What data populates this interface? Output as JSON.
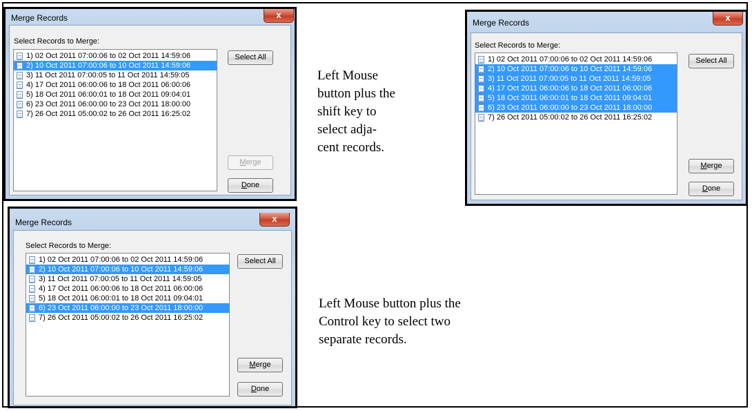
{
  "dialog": {
    "title": "Merge Records",
    "close_glyph": "x",
    "prompt": "Select Records to Merge:",
    "select_all_label": "Select All",
    "merge_label_rest": "erge",
    "merge_label_mnemonic": "M",
    "done_label_rest": "one",
    "done_label_mnemonic": "D"
  },
  "records": [
    "1) 02 Oct 2011 07:00:06 to 02 Oct 2011 14:59:06",
    "2) 10 Oct 2011 07:00:06 to 10 Oct 2011 14:59:06",
    "3) 11 Oct 2011 07:00:05 to 11 Oct 2011 14:59:05",
    "4) 17 Oct 2011 06:00:06 to 18 Oct 2011 06:00:06",
    "5) 18 Oct 2011 06:00:01 to 18 Oct 2011 09:04:01",
    "6) 23 Oct 2011 06:00:00 to 23 Oct 2011 18:00:00",
    "7) 26 Oct 2011 05:00:02 to 26 Oct 2011 16:25:02"
  ],
  "panels": {
    "single": {
      "selected": [
        2
      ],
      "merge_enabled": false
    },
    "shift": {
      "selected": [
        2,
        3,
        4,
        5,
        6
      ],
      "merge_enabled": true
    },
    "control": {
      "selected": [
        2,
        6
      ],
      "merge_enabled": true
    }
  },
  "captions": {
    "shift": [
      "Left Mouse",
      "button plus the",
      "shift key to",
      "select adja-",
      "cent records."
    ],
    "control": [
      "Left Mouse button plus the",
      "Control key to select two",
      "separate records."
    ]
  },
  "colors": {
    "selection": "#3399ff",
    "close_button": "#c43f27"
  }
}
